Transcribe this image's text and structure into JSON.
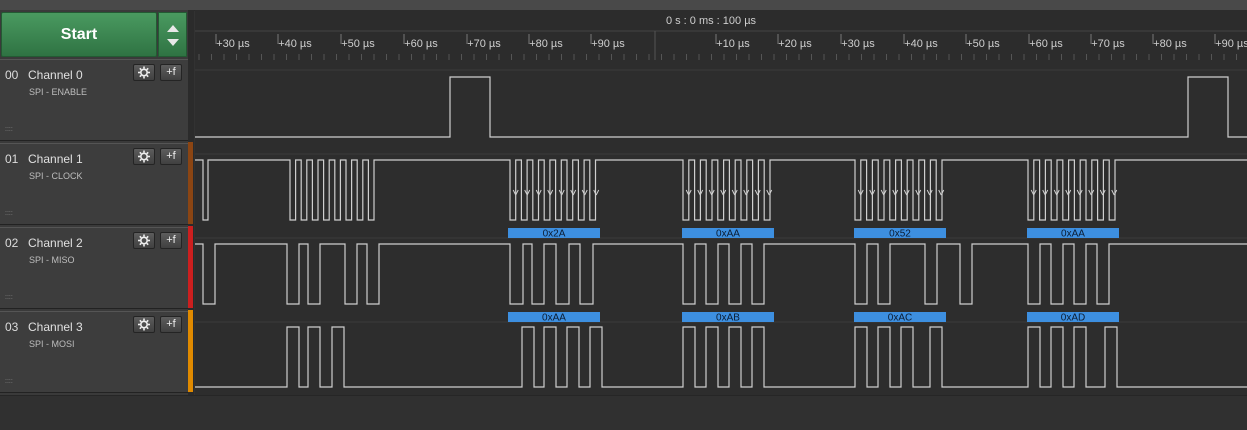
{
  "toolbar": {
    "start_label": "Start"
  },
  "timeline": {
    "header": "0 s : 0 ms : 100 µs",
    "ticks_left": [
      "+30 µs",
      "+40 µs",
      "+50 µs",
      "+60 µs",
      "+70 µs",
      "+80 µs",
      "+90 µs"
    ],
    "ticks_right": [
      "+10 µs",
      "+20 µs",
      "+30 µs",
      "+40 µs",
      "+50 µs",
      "+60 µs",
      "+70 µs",
      "+80 µs",
      "+90 µs"
    ]
  },
  "channels": [
    {
      "num": "00",
      "name": "Channel 0",
      "sub": "SPI - ENABLE",
      "color": "#2b2b2b"
    },
    {
      "num": "01",
      "name": "Channel 1",
      "sub": "SPI - CLOCK",
      "color": "#8b4513"
    },
    {
      "num": "02",
      "name": "Channel 2",
      "sub": "SPI - MISO",
      "color": "#cc1f1f"
    },
    {
      "num": "03",
      "name": "Channel 3",
      "sub": "SPI - MOSI",
      "color": "#e08a00"
    }
  ],
  "channel_buttons": {
    "settings_icon": "gear-icon",
    "trigger_icon": "trigger-edge-icon",
    "trigger_text": "+f"
  },
  "decoded": {
    "miso": [
      "0x2A",
      "0xAA",
      "0x52",
      "0xAA"
    ],
    "mosi": [
      "0xAA",
      "0xAB",
      "0xAC",
      "0xAD"
    ]
  },
  "colors": {
    "start_green": "#3d8a52",
    "signal": "#cfcfcf",
    "decode_bubble": "#3d8fe0"
  }
}
